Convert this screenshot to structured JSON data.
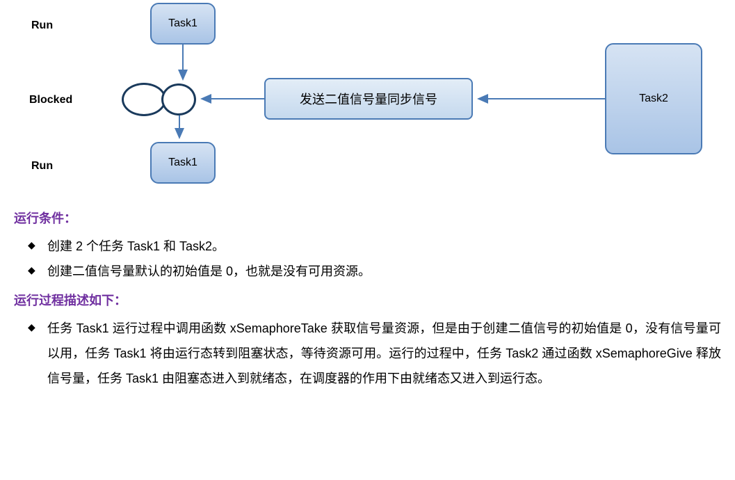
{
  "diagram": {
    "rowLabels": {
      "run1": "Run",
      "blocked": "Blocked",
      "run2": "Run"
    },
    "task1Top": "Task1",
    "task1Bottom": "Task1",
    "task2": "Task2",
    "messageBox": "发送二值信号量同步信号"
  },
  "text": {
    "conditionsHeading": "运行条件：",
    "cond1": "创建 2 个任务 Task1 和 Task2。",
    "cond2": "创建二值信号量默认的初始值是 0，也就是没有可用资源。",
    "processHeading": "运行过程描述如下：",
    "proc1": "任务 Task1 运行过程中调用函数 xSemaphoreTake 获取信号量资源，但是由于创建二值信号的初始值是 0，没有信号量可以用，任务 Task1 将由运行态转到阻塞状态，等待资源可用。运行的过程中，任务 Task2 通过函数 xSemaphoreGive 释放信号量，任务 Task1 由阻塞态进入到就绪态，在调度器的作用下由就绪态又进入到运行态。"
  }
}
